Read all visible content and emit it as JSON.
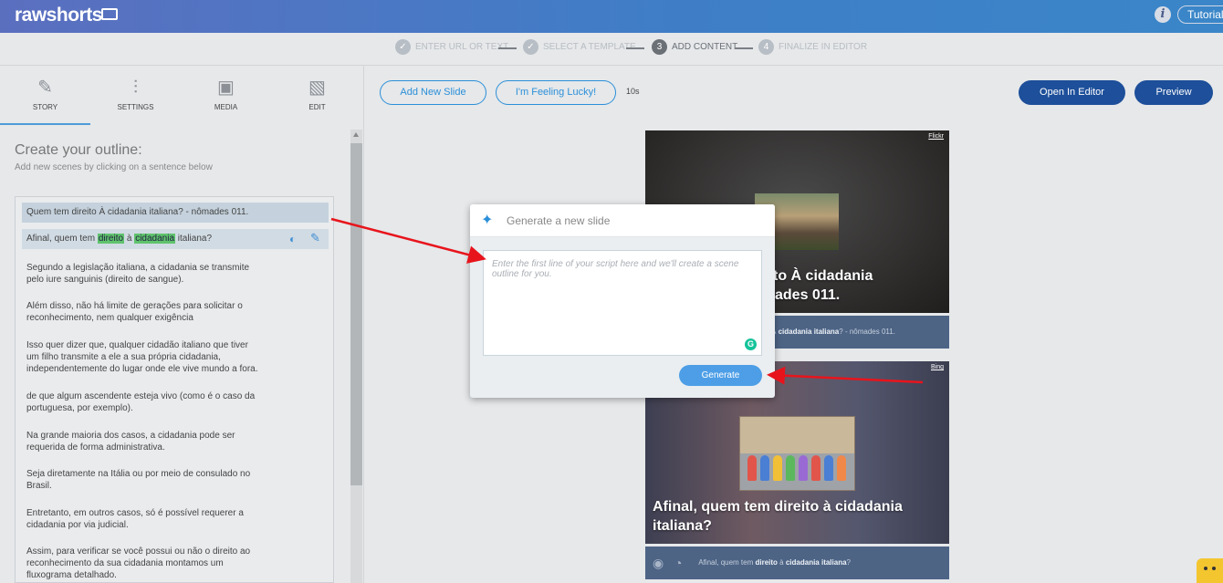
{
  "app": {
    "logo_bold": "rawshorts",
    "tutorial_label": "Tutorial"
  },
  "steps": [
    {
      "label": "ENTER URL OR TEXT",
      "state": "done"
    },
    {
      "label": "SELECT A TEMPLATE",
      "state": "done"
    },
    {
      "label": "ADD CONTENT",
      "number": "3",
      "state": "active"
    },
    {
      "label": "FINALIZE IN EDITOR",
      "number": "4",
      "state": "pending"
    }
  ],
  "tabs": [
    {
      "label": "STORY",
      "icon": "story-icon"
    },
    {
      "label": "SETTINGS",
      "icon": "sliders-icon"
    },
    {
      "label": "MEDIA",
      "icon": "image-icon"
    },
    {
      "label": "EDIT",
      "icon": "edit-image-icon"
    }
  ],
  "outline": {
    "title": "Create your outline:",
    "subtitle": "Add new scenes by clicking on a sentence below",
    "items": [
      "Quem tem direito À cidadania italiana? - nômades 011.",
      "Segundo a legislação italiana, a cidadania se transmite",
      "pelo iure sanguinis (direito de sangue).",
      "Além disso, não há limite de gerações para solicitar o",
      "reconhecimento, nem qualquer exigência",
      "Isso quer dizer que, qualquer cidadão italiano que tiver",
      "um filho transmite a ele a sua própria cidadania,",
      "independentemente do lugar onde ele vive mundo a fora.",
      "de que algum ascendente esteja vivo (como é o caso da",
      "portuguesa, por exemplo).",
      "Na grande maioria dos casos, a cidadania pode ser",
      "requerida de forma administrativa.",
      "Seja diretamente na Itália ou por meio de consulado no",
      "Brasil.",
      "Entretanto, em outros casos, só é possível requerer a",
      "cidadania por via judicial.",
      "Assim, para verificar se você possui ou não o direito ao",
      "reconhecimento da sua cidadania montamos um",
      "fluxograma detalhado."
    ],
    "item2_parts": [
      "Afinal, quem tem ",
      "direito",
      " à ",
      "cidadania",
      " italiana?"
    ]
  },
  "toolbar": {
    "add_slide": "Add New Slide",
    "feeling_lucky": "I'm Feeling Lucky!",
    "duration": "10s",
    "open_editor": "Open In Editor",
    "preview": "Preview"
  },
  "slides": [
    {
      "source": "Flickr",
      "caption_line1": "to À cidadania",
      "caption_line2": "ades 011.",
      "sub_prefix": "À ",
      "sub_bold": "cidadania italiana",
      "sub_suffix": "? - nômades 011."
    },
    {
      "source": "Bing",
      "caption_line1": "Afinal, quem tem direito à cidadania",
      "caption_line2": "italiana?",
      "sub_prefix": "Afinal, quem tem ",
      "sub_bold1": "direito",
      "sub_mid": " à ",
      "sub_bold2": "cidadania italiana",
      "sub_suffix": "?"
    }
  ],
  "modal": {
    "title": "Generate a new slide",
    "placeholder": "Enter the first line of your script here and we'll create a scene outline for you.",
    "generate_label": "Generate"
  },
  "colors": {
    "primary_blue": "#2b8fd8",
    "dark_blue": "#1d4f9a",
    "highlight_green": "#5fc36d",
    "arrow_red": "#e8141c"
  }
}
